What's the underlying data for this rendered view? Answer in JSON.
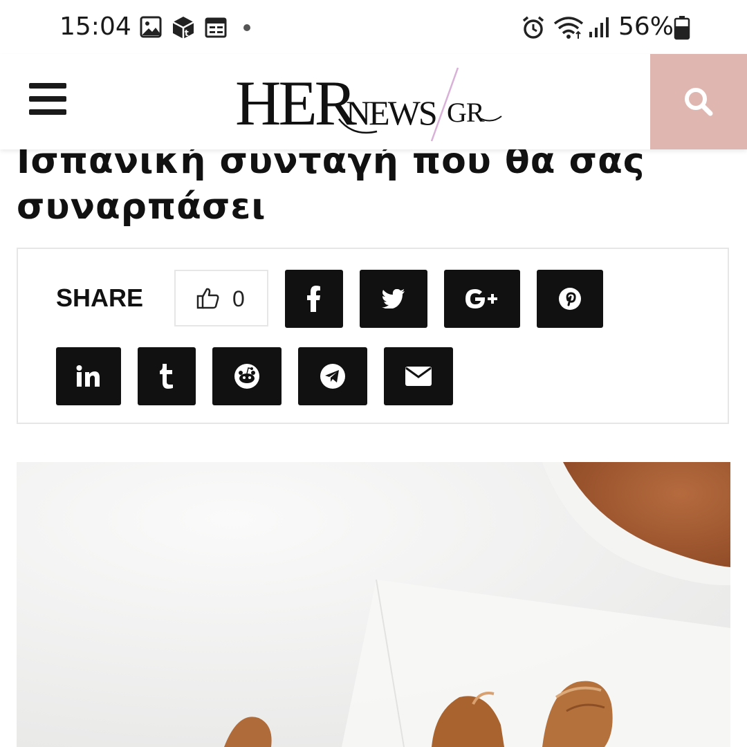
{
  "status_bar": {
    "time": "15:04",
    "battery_percent": "56%",
    "left_icons": [
      "gallery-icon",
      "package-icon",
      "calendar-icon"
    ],
    "right_icons": [
      "alarm-icon",
      "wifi-icon",
      "signal-icon",
      "battery-icon"
    ]
  },
  "header": {
    "menu_icon": "hamburger-icon",
    "logo": "HERNEWS GR",
    "search_icon": "search-icon"
  },
  "article": {
    "headline": "Ισπανική συνταγή που θα σας συναρπάσει"
  },
  "share": {
    "label": "SHARE",
    "like_count": "0",
    "buttons": [
      "facebook",
      "twitter",
      "google-plus",
      "pinterest",
      "linkedin",
      "tumblr",
      "reddit",
      "telegram",
      "email"
    ]
  },
  "colors": {
    "accent": "#dfb6b0",
    "share_button_bg": "#111111",
    "text": "#111111"
  }
}
